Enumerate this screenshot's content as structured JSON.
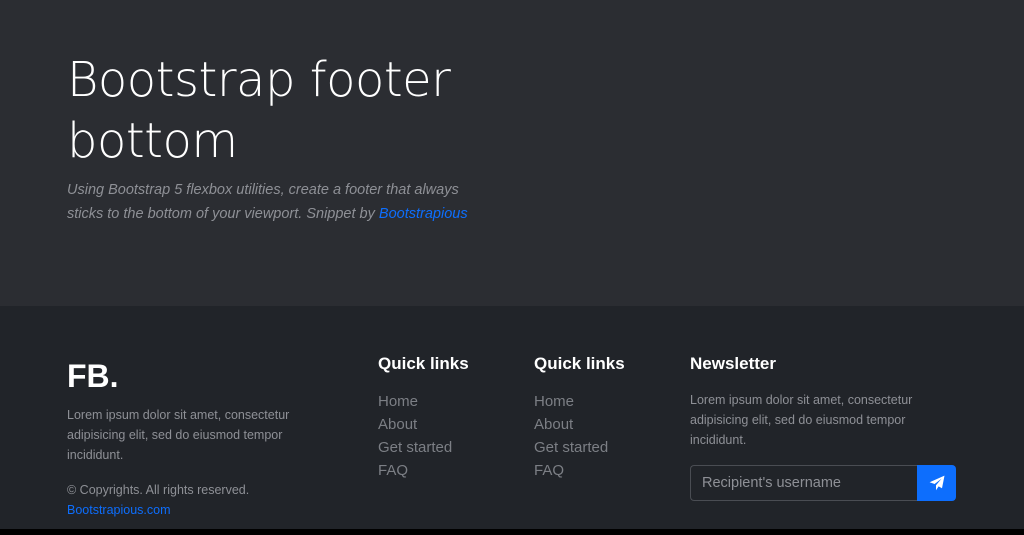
{
  "hero": {
    "title": "Bootstrap footer bottom",
    "lead_text": "Using Bootstrap 5 flexbox utilities, create a footer that always sticks to the bottom of your viewport. Snippet by",
    "lead_link": "Bootstrapious"
  },
  "footer": {
    "brand": "FB.",
    "about": "Lorem ipsum dolor sit amet, consectetur adipisicing elit, sed do eiusmod tempor incididunt.",
    "copyright": "© Copyrights. All rights reserved.",
    "copyright_link": "Bootstrapious.com",
    "columns": [
      {
        "title": "Quick links",
        "links": [
          "Home",
          "About",
          "Get started",
          "FAQ"
        ]
      },
      {
        "title": "Quick links",
        "links": [
          "Home",
          "About",
          "Get started",
          "FAQ"
        ]
      }
    ],
    "newsletter": {
      "title": "Newsletter",
      "text": "Lorem ipsum dolor sit amet, consectetur adipisicing elit, sed do eiusmod tempor incididunt.",
      "input_placeholder": "Recipient's username",
      "input_value": "",
      "button_icon": "paper-plane-icon"
    }
  },
  "colors": {
    "hero_bg": "#2b2d32",
    "footer_bg": "#212429",
    "accent": "#0d6efd"
  }
}
